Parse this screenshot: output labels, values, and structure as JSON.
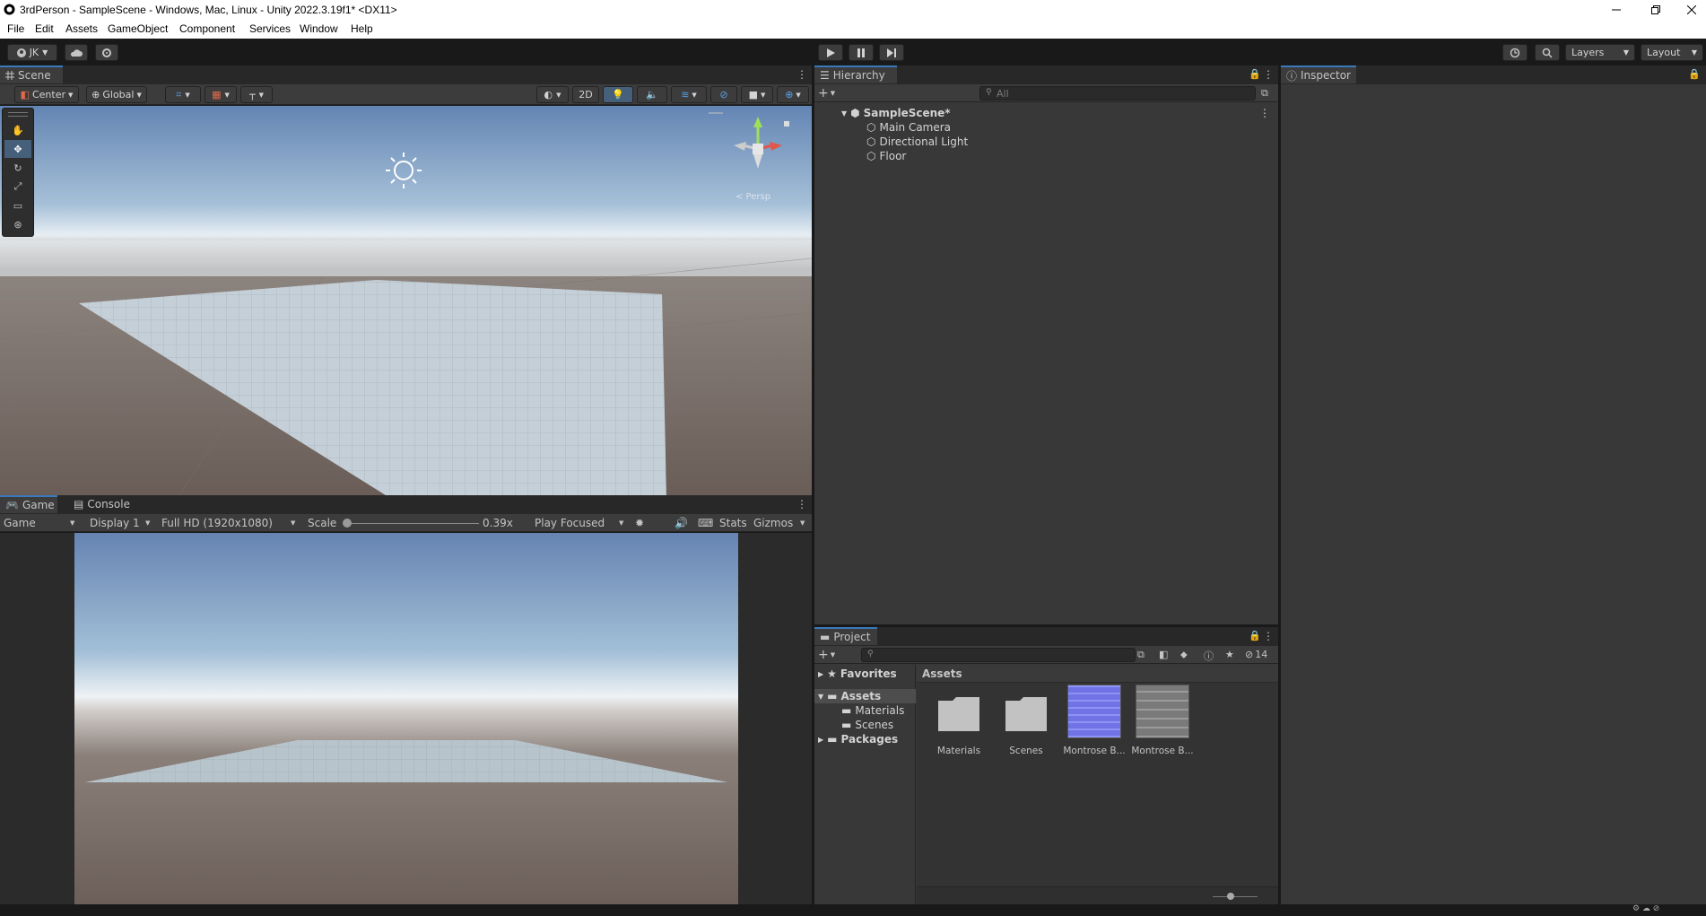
{
  "window": {
    "title": "3rdPerson - SampleScene - Windows, Mac, Linux - Unity 2022.3.19f1* <DX11>"
  },
  "menu": [
    "File",
    "Edit",
    "Assets",
    "GameObject",
    "Component",
    "Services",
    "Window",
    "Help"
  ],
  "toolbar": {
    "account": "JK",
    "layers": "Layers",
    "layout": "Layout"
  },
  "scene": {
    "tab": "Scene",
    "pivot": "Center",
    "space": "Global",
    "mode2d": "2D",
    "persp": "< Persp"
  },
  "game": {
    "tab_game": "Game",
    "tab_console": "Console",
    "view": "Game",
    "display": "Display 1",
    "resolution": "Full HD (1920x1080)",
    "scale_label": "Scale",
    "scale_value": "0.39x",
    "play_mode": "Play Focused",
    "stats": "Stats",
    "gizmos": "Gizmos",
    "scale_fraction": 0
  },
  "hierarchy": {
    "tab": "Hierarchy",
    "search_placeholder": "All",
    "scene": "SampleScene*",
    "items": [
      "Main Camera",
      "Directional Light",
      "Floor"
    ]
  },
  "inspector": {
    "tab": "Inspector"
  },
  "project": {
    "tab": "Project",
    "hidden_count": "14",
    "favorites": "Favorites",
    "assets": "Assets",
    "asset_folders": [
      "Materials",
      "Scenes"
    ],
    "packages": "Packages",
    "breadcrumb": "Assets",
    "grid": [
      {
        "label": "Materials",
        "kind": "folder"
      },
      {
        "label": "Scenes",
        "kind": "folder"
      },
      {
        "label": "Montrose B...",
        "kind": "normalmap"
      },
      {
        "label": "Montrose B...",
        "kind": "texture"
      }
    ]
  },
  "colors": {
    "accent": "#3a79bb",
    "panel": "#383838",
    "toolbar": "#191919",
    "selection": "#2c5d87"
  }
}
